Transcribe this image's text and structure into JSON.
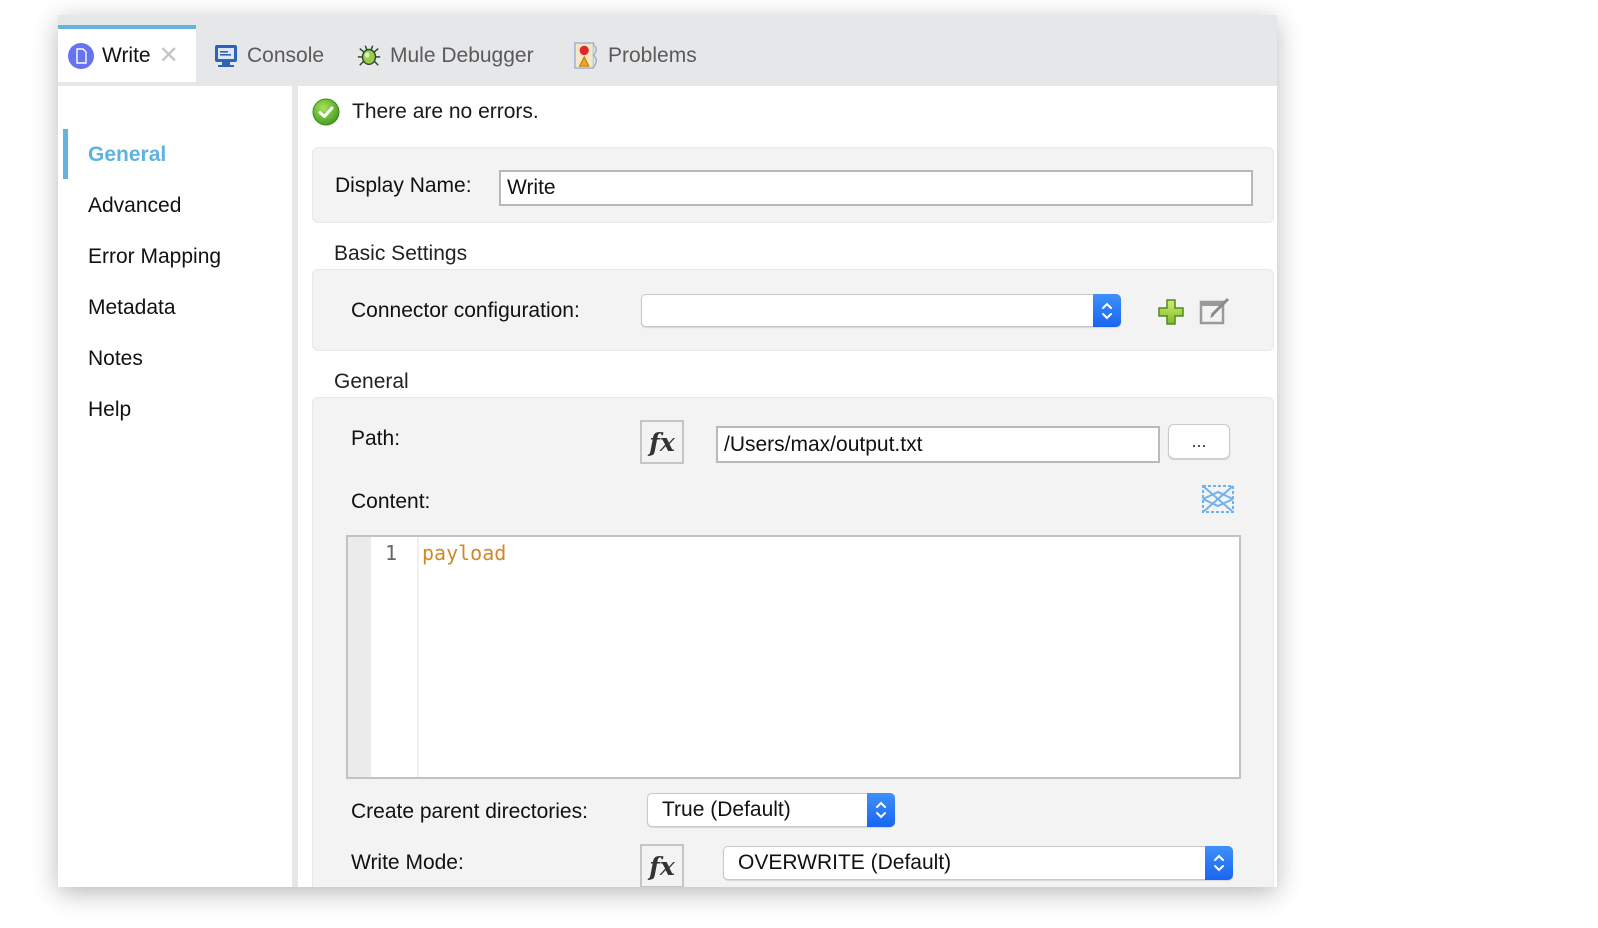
{
  "tabs": [
    {
      "label": "Write",
      "icon": "document-icon",
      "active": true,
      "closable": true
    },
    {
      "label": "Console",
      "icon": "console-icon"
    },
    {
      "label": "Mule Debugger",
      "icon": "bug-icon"
    },
    {
      "label": "Problems",
      "icon": "problems-icon"
    }
  ],
  "tab_close_glyph": "✕",
  "sidebar": {
    "items": [
      {
        "label": "General",
        "active": true
      },
      {
        "label": "Advanced"
      },
      {
        "label": "Error Mapping"
      },
      {
        "label": "Metadata"
      },
      {
        "label": "Notes"
      },
      {
        "label": "Help"
      }
    ]
  },
  "status": {
    "message": "There are no errors.",
    "icon": "check-circle-icon",
    "color": "#5fb52e"
  },
  "display_name": {
    "label": "Display Name:",
    "value": "Write"
  },
  "basic_settings": {
    "title": "Basic Settings",
    "connector_config": {
      "label": "Connector configuration:",
      "value": ""
    },
    "add_icon": "plus-icon",
    "edit_icon": "edit-icon"
  },
  "general": {
    "title": "General",
    "path": {
      "label": "Path:",
      "fx_label": "fx",
      "value": "/Users/max/output.txt",
      "browse_label": "..."
    },
    "content": {
      "label": "Content:",
      "line_numbers": [
        "1"
      ],
      "code": "payload",
      "mapping_icon": "transform-map-icon"
    },
    "create_parent_dirs": {
      "label": "Create parent directories:",
      "value": "True (Default)"
    },
    "write_mode": {
      "label": "Write Mode:",
      "fx_label": "fx",
      "value": "OVERWRITE (Default)"
    }
  },
  "colors": {
    "accent": "#64b5dc",
    "select_blue": "#2a78f6",
    "code_keyword": "#cf8a26"
  }
}
